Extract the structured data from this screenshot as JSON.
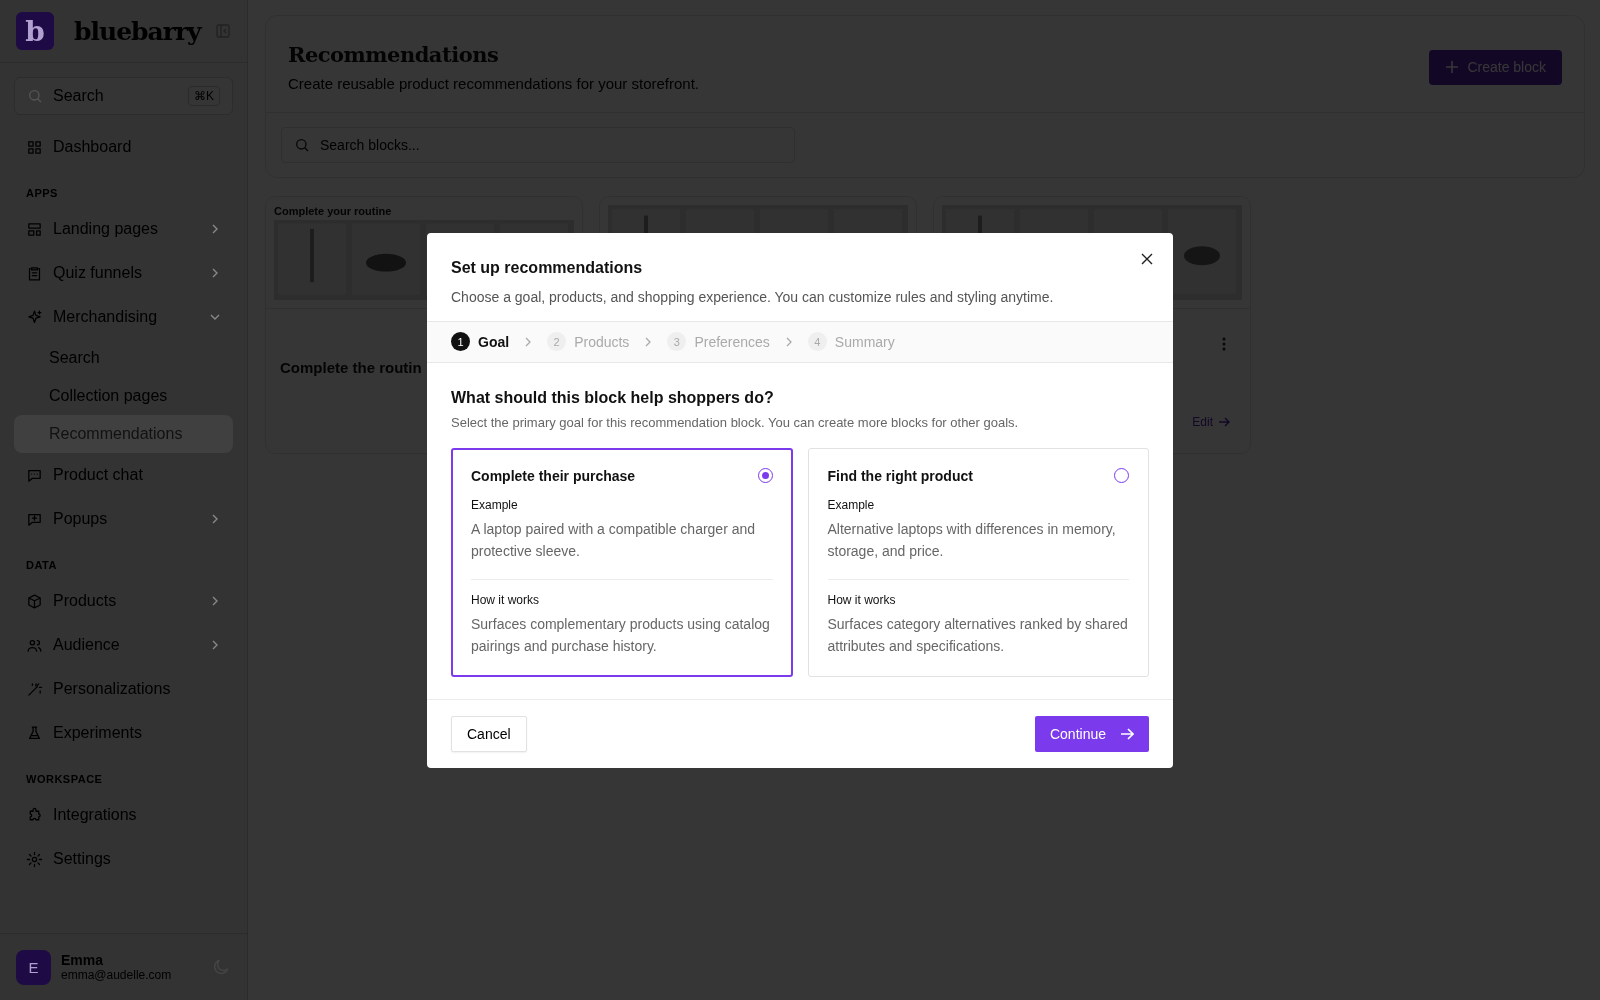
{
  "sidebar": {
    "logo_letter": "b",
    "brand": "bluebarry",
    "search": {
      "placeholder": "Search",
      "shortcut": "⌘K"
    },
    "groups": [
      {
        "items": [
          {
            "label": "Dashboard",
            "expandable": false,
            "selected": false
          }
        ]
      },
      {
        "heading": "APPS",
        "items": [
          {
            "label": "Landing pages",
            "expandable": true,
            "expanded": false,
            "selected": false
          },
          {
            "label": "Quiz funnels",
            "expandable": true,
            "expanded": false,
            "selected": false
          },
          {
            "label": "Merchandising",
            "expandable": true,
            "expanded": true,
            "selected": false,
            "children": [
              {
                "label": "Search",
                "selected": false
              },
              {
                "label": "Collection pages",
                "selected": false
              },
              {
                "label": "Recommendations",
                "selected": true
              }
            ]
          },
          {
            "label": "Product chat",
            "expandable": false,
            "selected": false
          },
          {
            "label": "Popups",
            "expandable": true,
            "expanded": false,
            "selected": false
          }
        ]
      },
      {
        "heading": "DATA",
        "items": [
          {
            "label": "Products",
            "expandable": true,
            "expanded": false,
            "selected": false
          },
          {
            "label": "Audience",
            "expandable": true,
            "expanded": false,
            "selected": false
          },
          {
            "label": "Personalizations",
            "expandable": false,
            "selected": false
          },
          {
            "label": "Experiments",
            "expandable": false,
            "selected": false
          }
        ]
      },
      {
        "heading": "WORKSPACE",
        "items": [
          {
            "label": "Integrations",
            "expandable": false,
            "selected": false
          },
          {
            "label": "Settings",
            "expandable": false,
            "selected": false
          }
        ]
      }
    ],
    "user": {
      "initial": "E",
      "name": "Emma",
      "email": "emma@audelle.com"
    }
  },
  "page": {
    "title": "Recommendations",
    "subtitle": "Create reusable product recommendations for your storefront.",
    "create_button": "Create block",
    "search": {
      "placeholder": "Search blocks..."
    },
    "blocks": [
      {
        "kind": "card",
        "preview_title": "Complete your routine",
        "title": "Complete the routin"
      },
      {
        "kind": "card"
      },
      {
        "kind": "card",
        "menu": true,
        "edit": "Edit"
      }
    ]
  },
  "modal": {
    "title": "Set up recommendations",
    "subtitle": "Choose a goal, products, and shopping experience. You can customize rules and styling anytime.",
    "steps": [
      {
        "number": "1",
        "label": "Goal",
        "selected": true
      },
      {
        "number": "2",
        "label": "Products",
        "selected": false
      },
      {
        "number": "3",
        "label": "Preferences",
        "selected": false
      },
      {
        "number": "4",
        "label": "Summary",
        "selected": false
      }
    ],
    "question": "What should this block help shoppers do?",
    "hint": "Select the primary goal for this recommendation block. You can create more blocks for other goals.",
    "options": [
      {
        "title": "Complete their purchase",
        "selected": true,
        "example_label": "Example",
        "example": "A laptop paired with a compatible charger and protective sleeve.",
        "how_label": "How it works",
        "how": "Surfaces complementary products using catalog pairings and purchase history."
      },
      {
        "title": "Find the right product",
        "selected": false,
        "example_label": "Example",
        "example": "Alternative laptops with differences in memory, storage, and price.",
        "how_label": "How it works",
        "how": "Surfaces category alternatives ranked by shared attributes and specifications."
      }
    ],
    "cancel": "Cancel",
    "continue": "Continue"
  }
}
